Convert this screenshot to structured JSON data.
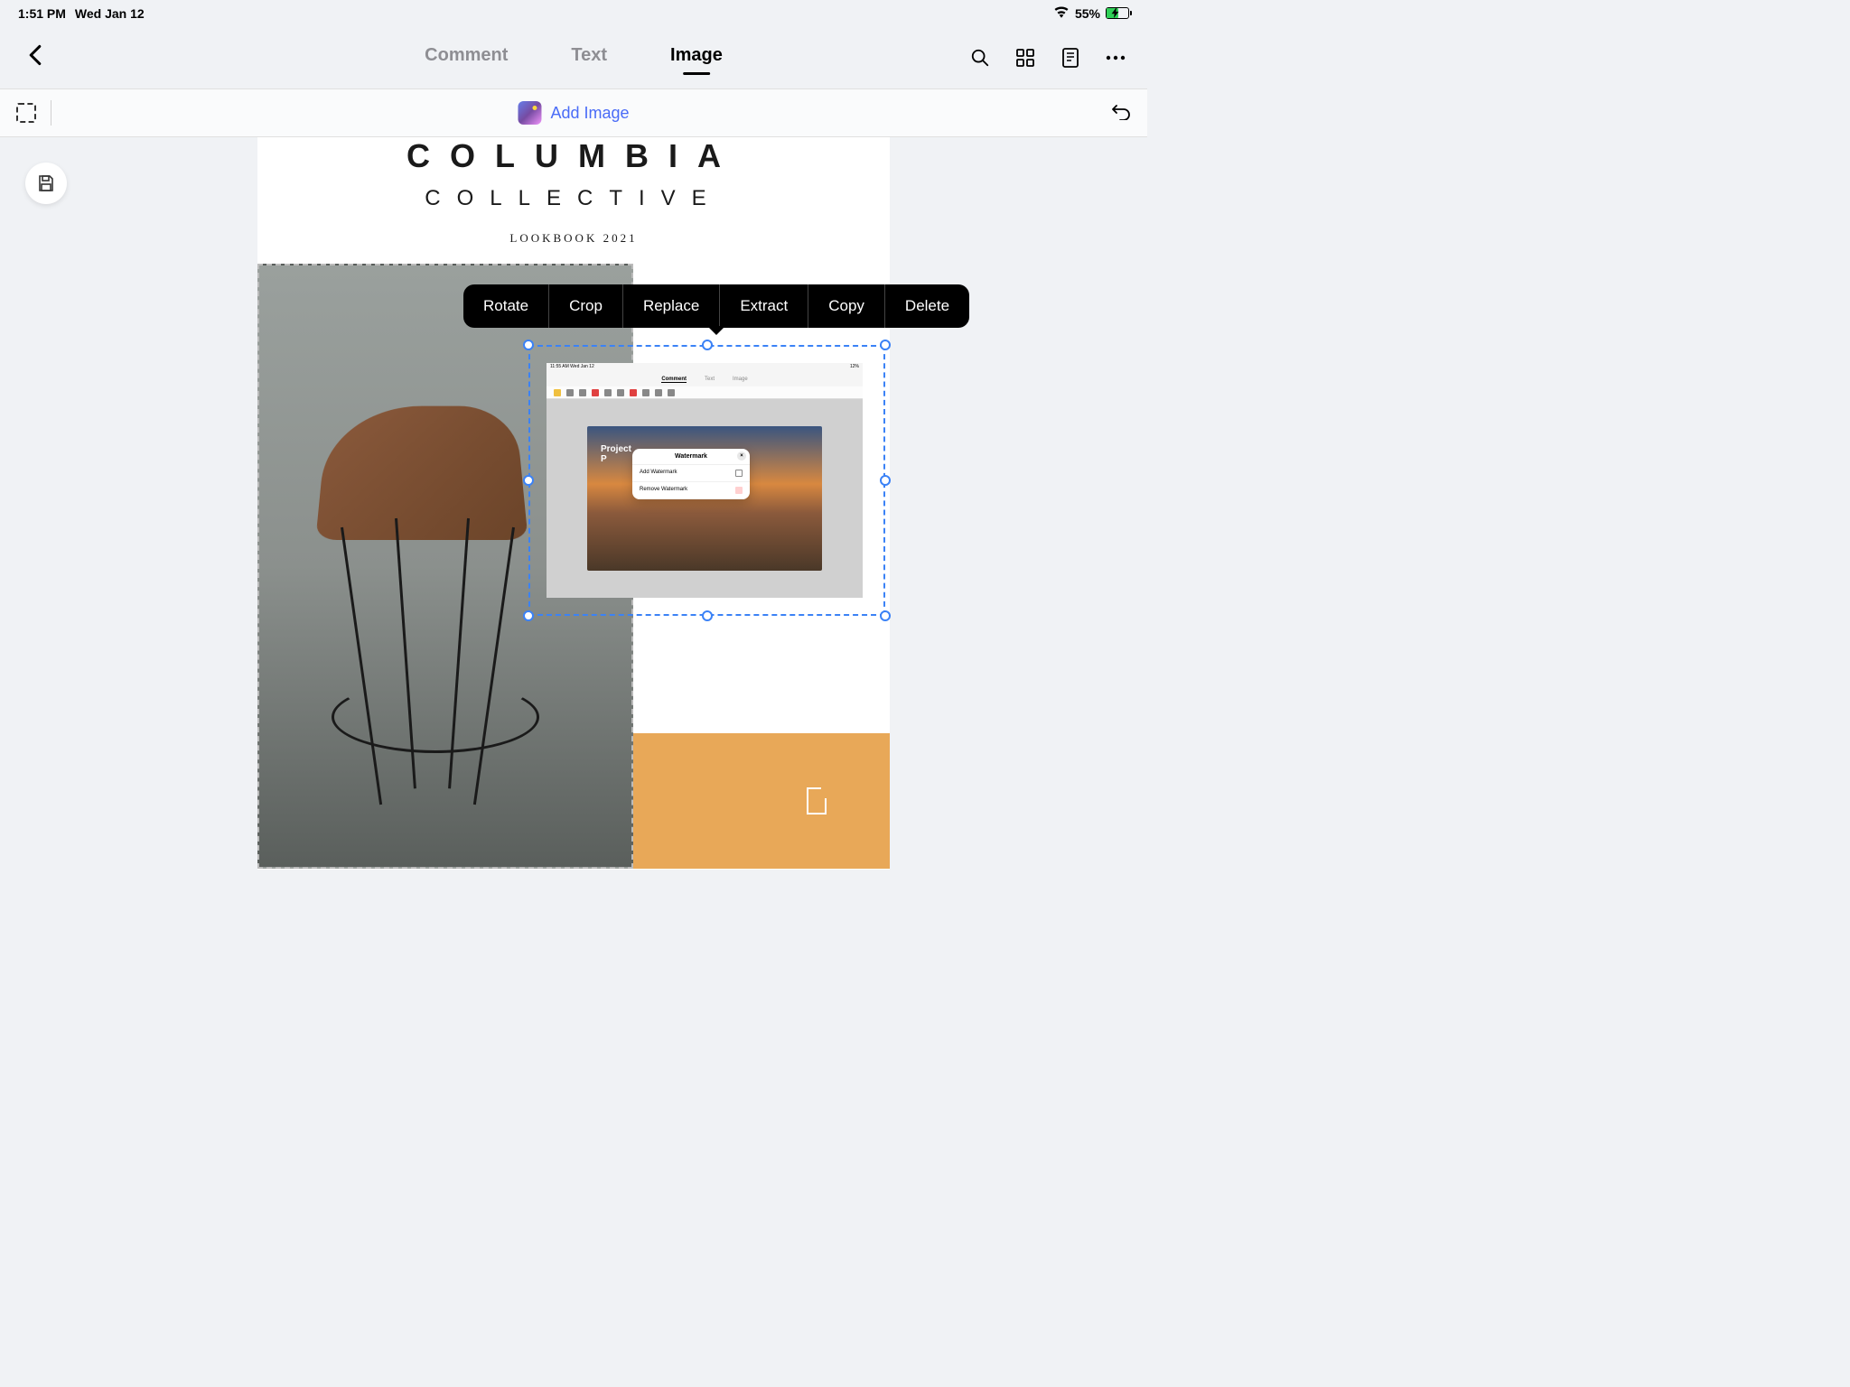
{
  "status": {
    "time": "1:51 PM",
    "date": "Wed Jan 12",
    "battery_pct": "55%"
  },
  "nav": {
    "tabs": [
      {
        "label": "Comment",
        "active": false
      },
      {
        "label": "Text",
        "active": false
      },
      {
        "label": "Image",
        "active": true
      }
    ]
  },
  "toolbar": {
    "add_image_label": "Add Image"
  },
  "context_menu": {
    "items": [
      {
        "label": "Rotate"
      },
      {
        "label": "Crop"
      },
      {
        "label": "Replace"
      },
      {
        "label": "Extract"
      },
      {
        "label": "Copy"
      },
      {
        "label": "Delete"
      }
    ]
  },
  "document": {
    "title_main": "COLUMBIA",
    "title_sub": "COLLECTIVE",
    "title_year": "LOOKBOOK 2021"
  },
  "inner_screenshot": {
    "status_time": "11:55 AM",
    "status_date": "Wed Jan 12",
    "status_batt": "12%",
    "nav_tabs": [
      "Comment",
      "Text",
      "Image"
    ],
    "truck_text_1": "Project",
    "truck_text_2": "P",
    "popup_title": "Watermark",
    "popup_items": [
      {
        "label": "Add Watermark"
      },
      {
        "label": "Remove Watermark"
      }
    ]
  }
}
